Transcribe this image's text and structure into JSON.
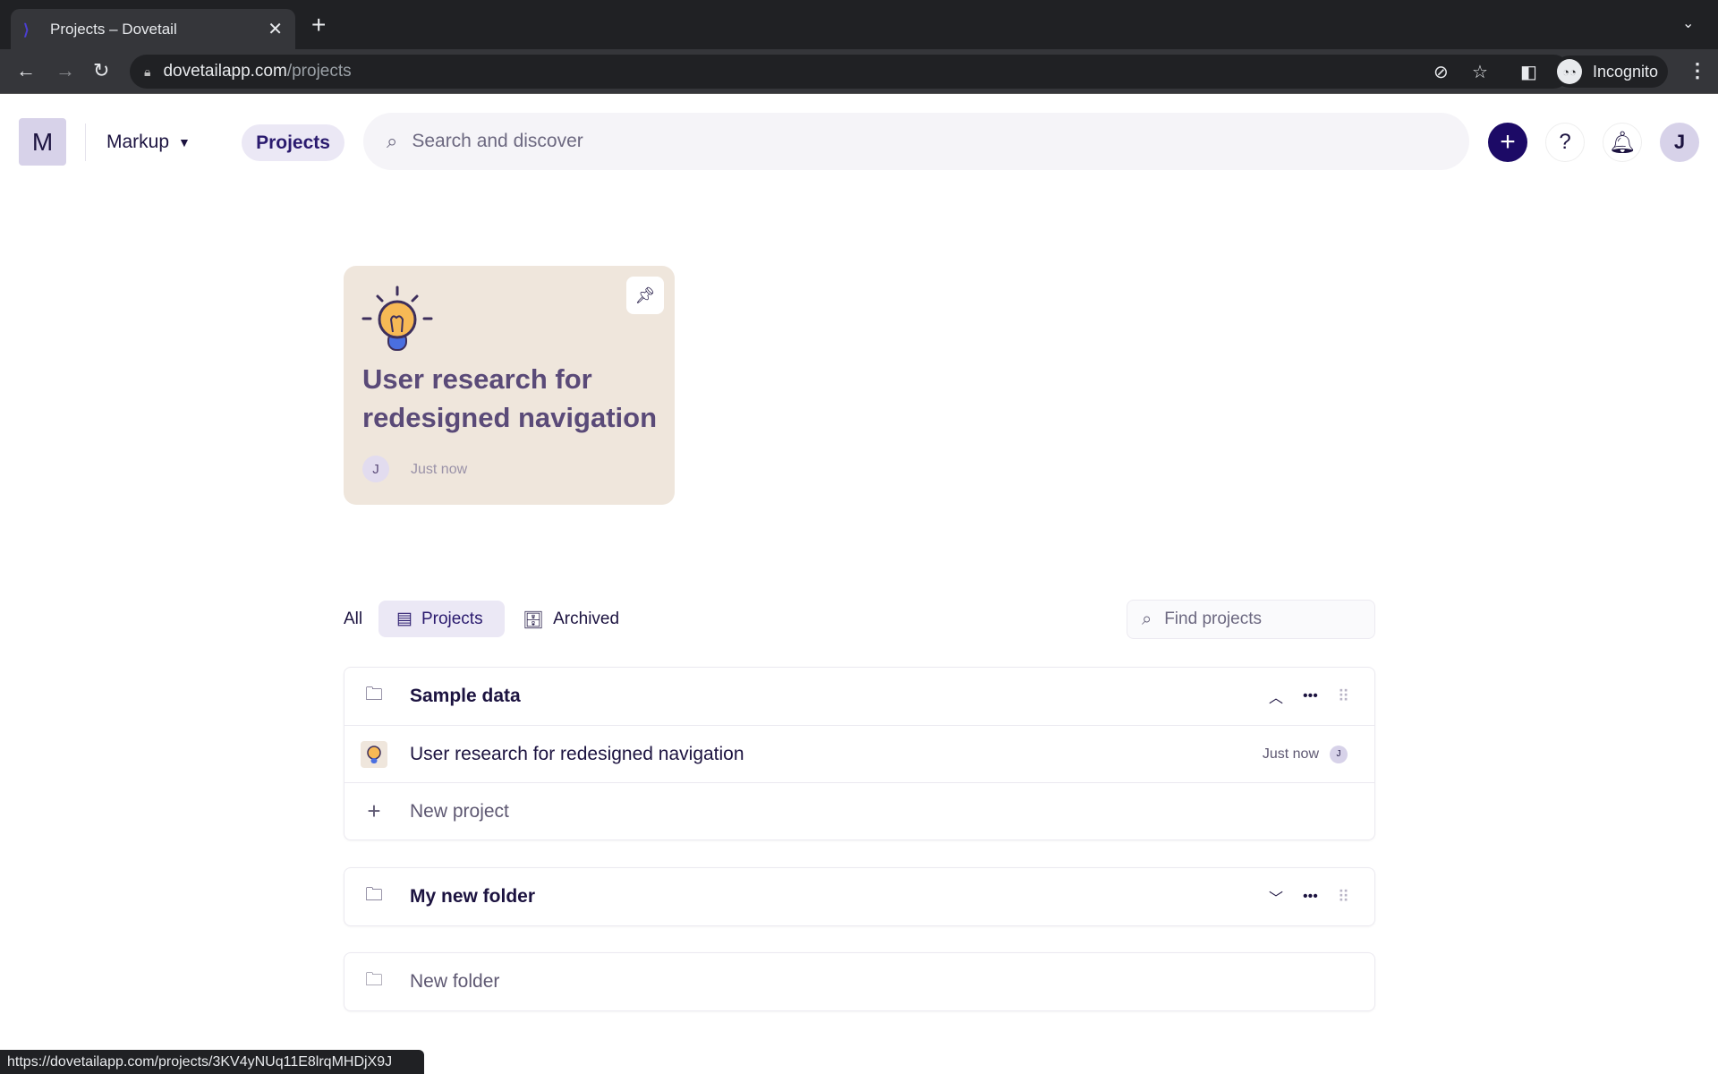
{
  "browser": {
    "tab_title": "Projects – Dovetail",
    "url_domain": "dovetailapp.com",
    "url_path": "/projects",
    "profile": "Incognito",
    "status_url": "https://dovetailapp.com/projects/3KV4yNUq11E8lrqMHDjX9J"
  },
  "header": {
    "workspace_initial": "M",
    "workspace_name": "Markup",
    "nav_projects": "Projects",
    "search_placeholder": "Search and discover",
    "avatar_initial": "J",
    "help_label": "?"
  },
  "pinned_card": {
    "title": "User research for redesigned navigation",
    "avatar": "J",
    "time": "Just now",
    "colors": {
      "background": "#efe6dc"
    }
  },
  "filters": {
    "all": "All",
    "projects": "Projects",
    "archived": "Archived",
    "find_placeholder": "Find projects"
  },
  "folders": [
    {
      "name": "Sample data",
      "expanded": true,
      "projects": [
        {
          "title": "User research for redesigned navigation",
          "time": "Just now",
          "avatar": "J"
        }
      ],
      "new_project": "New project"
    },
    {
      "name": "My new folder",
      "expanded": false
    }
  ],
  "new_folder": "New folder",
  "colors": {
    "accent": "#1c0a66",
    "pill": "#ebe8f5"
  }
}
